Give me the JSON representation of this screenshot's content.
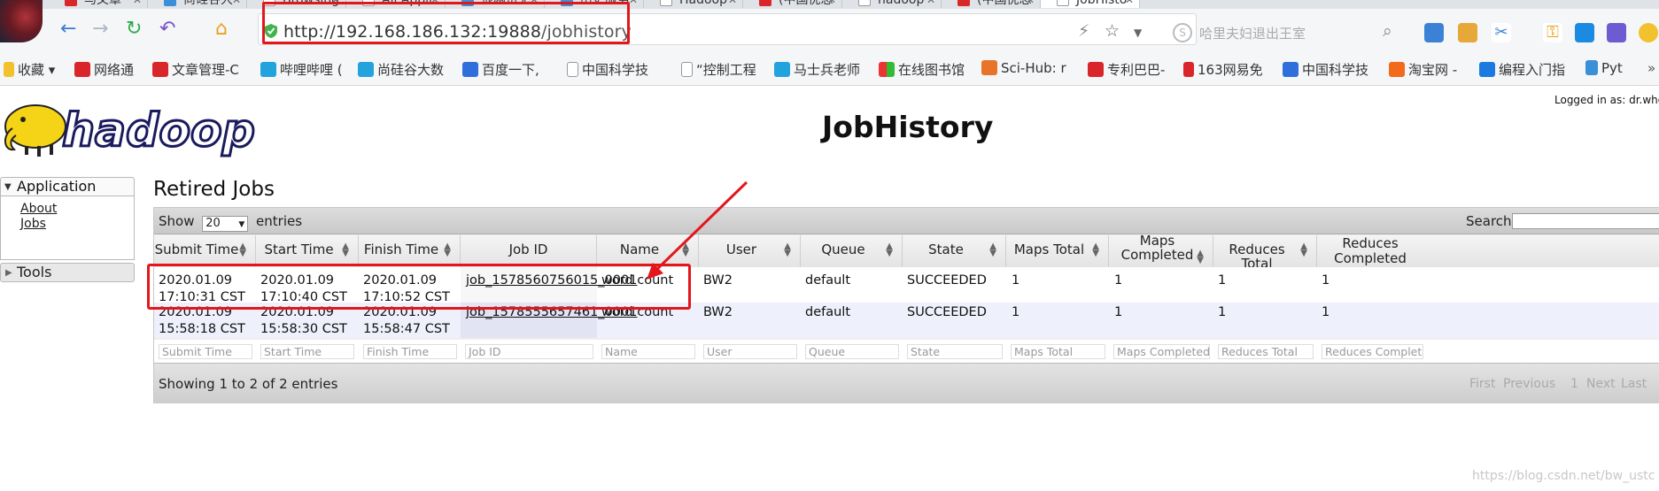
{
  "browser": {
    "tabs": [
      "马文章",
      "尚硅谷大",
      "Browsing",
      "All Appli",
      "很网页无",
      "历史服务",
      "Hadoop",
      "(中国优总",
      "hadoop",
      "(中国优总",
      "JobHisto"
    ],
    "address_url_host": "http://192.168.186.132:19888",
    "address_url_path": "/jobhistory",
    "search_placeholder": "哈里夫妇退出王室",
    "bookmarks": [
      "收藏",
      "网络通",
      "文章管理-C",
      "哔哩哔哩 (",
      "尚硅谷大数",
      "百度一下,",
      "中国科学技",
      "“控制工程",
      "马士兵老师",
      "在线图书馆",
      "Sci-Hub: r",
      "专利巴巴-",
      "163网易免",
      "中国科学技",
      "淘宝网 -",
      "编程入门指",
      "Pyt"
    ]
  },
  "header": {
    "logo_text": "hadoop",
    "title": "JobHistory",
    "logged_in": "Logged in as: dr.who"
  },
  "sidebar": {
    "application_label": "Application",
    "links": [
      "About",
      "Jobs"
    ],
    "tools_label": "Tools"
  },
  "main": {
    "section_title": "Retired Jobs",
    "show_label": "Show",
    "page_length": "20",
    "entries_label": "entries",
    "search_label": "Search:",
    "columns": [
      "Submit Time",
      "Start Time",
      "Finish Time",
      "Job ID",
      "Name",
      "User",
      "Queue",
      "State",
      "Maps Total",
      "Maps Completed",
      "Reduces Total",
      "Reduces Completed"
    ],
    "rows": [
      {
        "submit_date": "2020.01.09",
        "submit_time": "17:10:31 CST",
        "start_date": "2020.01.09",
        "start_time": "17:10:40 CST",
        "finish_date": "2020.01.09",
        "finish_time": "17:10:52 CST",
        "job_id": "job_1578560756015_0001",
        "name": "word count",
        "user": "BW2",
        "queue": "default",
        "state": "SUCCEEDED",
        "maps_total": "1",
        "maps_completed": "1",
        "reduces_total": "1",
        "reduces_completed": "1"
      },
      {
        "submit_date": "2020.01.09",
        "submit_time": "15:58:18 CST",
        "start_date": "2020.01.09",
        "start_time": "15:58:30 CST",
        "finish_date": "2020.01.09",
        "finish_time": "15:58:47 CST",
        "job_id": "job_1578555657461_0001",
        "name": "word count",
        "user": "BW2",
        "queue": "default",
        "state": "SUCCEEDED",
        "maps_total": "1",
        "maps_completed": "1",
        "reduces_total": "1",
        "reduces_completed": "1"
      }
    ],
    "filter_placeholders": [
      "Submit Time",
      "Start Time",
      "Finish Time",
      "Job ID",
      "Name",
      "User",
      "Queue",
      "State",
      "Maps Total",
      "Maps Completed",
      "Reduces Total",
      "Reduces Completed"
    ],
    "info": "Showing 1 to 2 of 2 entries",
    "pagination": [
      "First",
      "Previous",
      "1",
      "Next",
      "Last"
    ]
  },
  "watermark": "https://blog.csdn.net/bw_ustc",
  "colors": {
    "annotation_red": "#e3161b",
    "row_alt": "#eef0fb"
  }
}
